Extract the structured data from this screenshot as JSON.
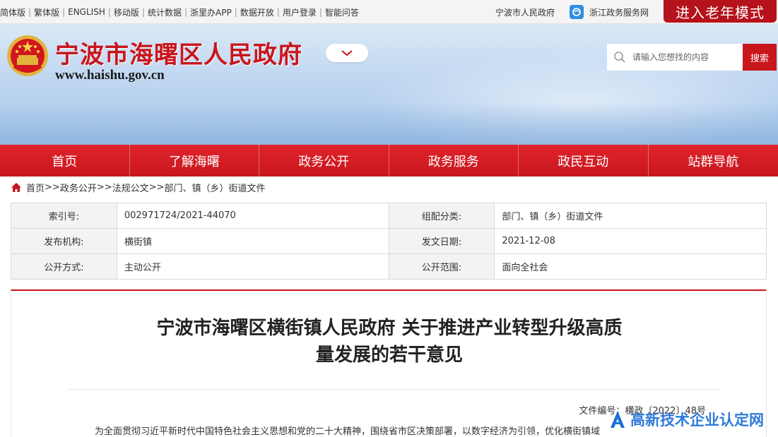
{
  "topbar": {
    "links": [
      "简体版",
      "繁体版",
      "ENGLISH",
      "移动版",
      "统计数据",
      "浙里办APP",
      "数据开放",
      "用户登录",
      "智能问答"
    ],
    "separator": "|",
    "city_gov_link": "宁波市人民政府",
    "zj_gov_link": "浙江政务服务网",
    "elder_mode": "进入老年模式"
  },
  "header": {
    "site_title": "宁波市海曙区人民政府",
    "site_url": "www.haishu.gov.cn",
    "search_placeholder": "请输入您想找的内容",
    "search_button": "搜索"
  },
  "nav": {
    "items": [
      "首页",
      "了解海曙",
      "政务公开",
      "政务服务",
      "政民互动",
      "站群导航"
    ]
  },
  "breadcrumb": {
    "items": [
      "首页",
      "政务公开",
      "法规公文",
      "部门、镇（乡）街道文件"
    ],
    "separator": ">>"
  },
  "meta": {
    "rows": [
      {
        "label1": "索引号:",
        "value1": "002971724/2021-44070",
        "label2": "组配分类:",
        "value2": "部门、镇（乡）街道文件"
      },
      {
        "label1": "发布机构:",
        "value1": "横街镇",
        "label2": "发文日期:",
        "value2": "2021-12-08"
      },
      {
        "label1": "公开方式:",
        "value1": "主动公开",
        "label2": "公开范围:",
        "value2": "面向全社会"
      }
    ]
  },
  "article": {
    "title_line1": "宁波市海曙区横街镇人民政府 关于推进产业转型升级高质",
    "title_line2": "量发展的若干意见",
    "doc_number": "文件编号：横政〔2022〕48号",
    "first_line": "为全面贯彻习近平新时代中国特色社会主义思想和党的二十大精神，围绕省市区决策部署，以数字经济为引领，优化横街镇域"
  },
  "watermark": {
    "text": "高新技术企业认定网"
  },
  "colors": {
    "brand_red": "#c8161d",
    "nav_red": "#e0242c",
    "watermark_blue": "#1e6fd6"
  },
  "icons": [
    "emblem-icon",
    "zj-gov-icon",
    "chevron-down-icon",
    "search-icon",
    "home-icon",
    "watermark-logo-icon"
  ]
}
